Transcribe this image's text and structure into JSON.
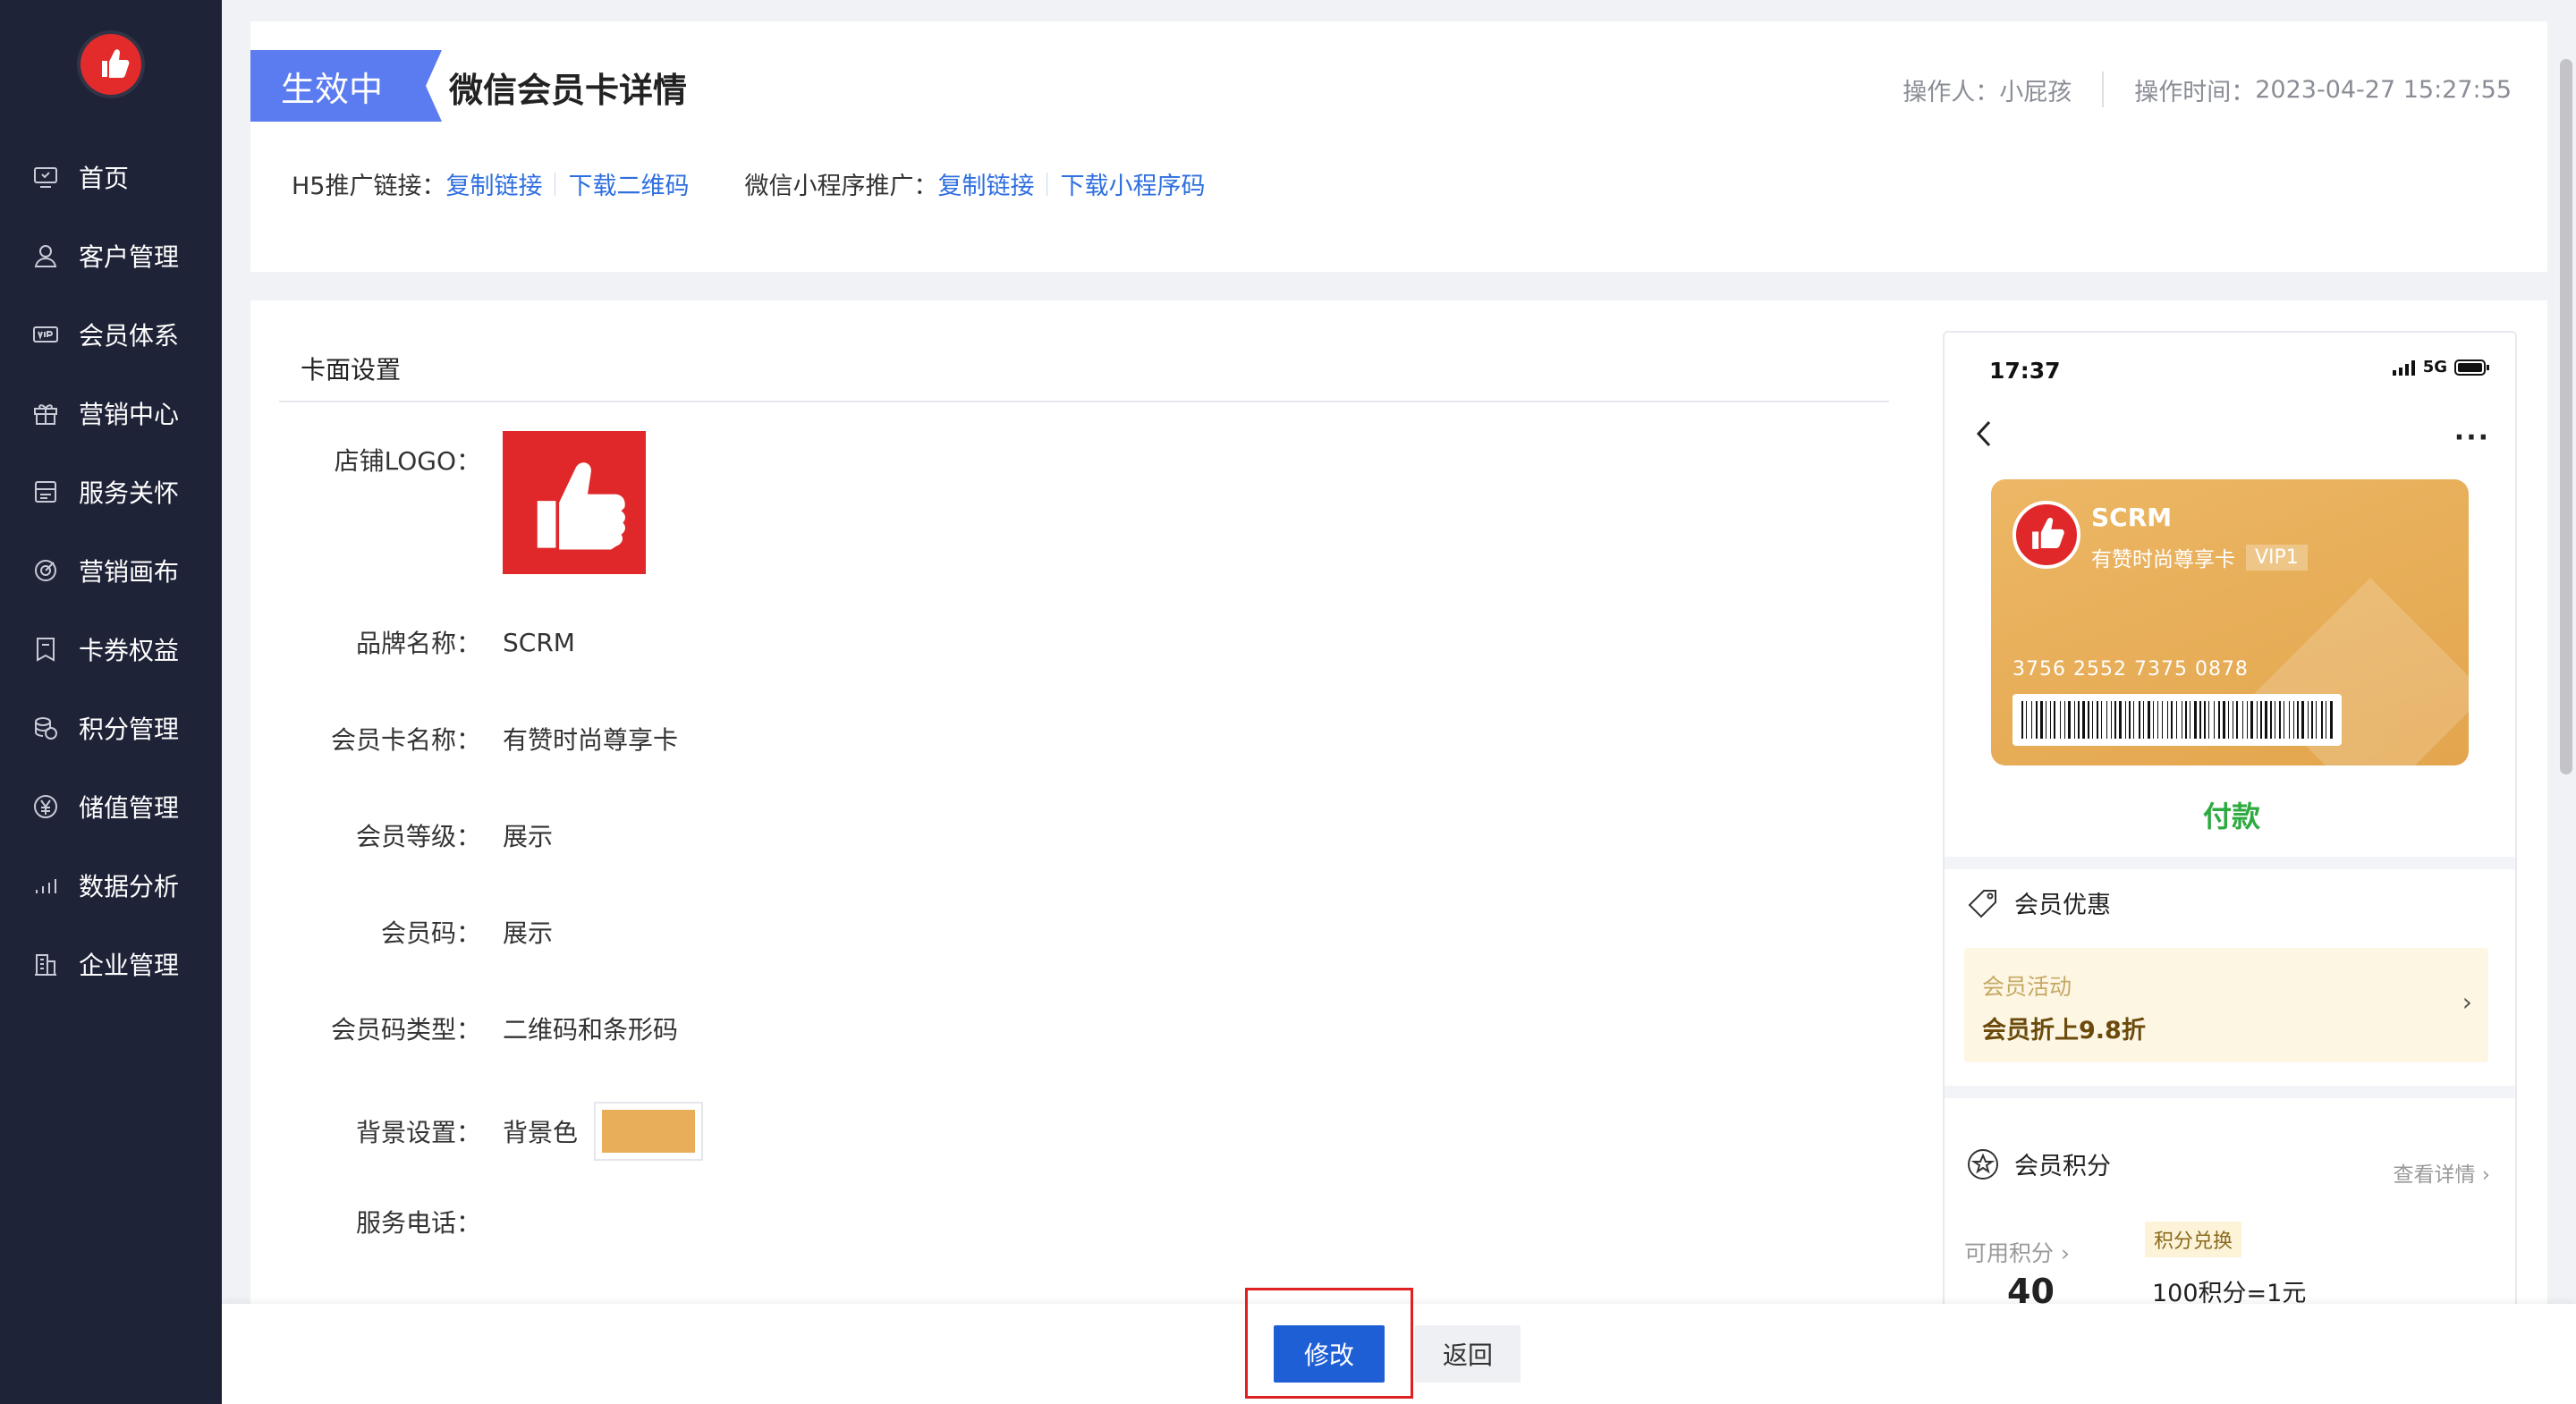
{
  "sidebar": {
    "logo_icon": "thumbs-up-icon",
    "items": [
      {
        "label": "首页",
        "icon": "home-icon"
      },
      {
        "label": "客户管理",
        "icon": "user-icon"
      },
      {
        "label": "会员体系",
        "icon": "vip-card-icon"
      },
      {
        "label": "营销中心",
        "icon": "gift-icon"
      },
      {
        "label": "服务关怀",
        "icon": "service-icon"
      },
      {
        "label": "营销画布",
        "icon": "target-icon"
      },
      {
        "label": "卡券权益",
        "icon": "coupon-icon"
      },
      {
        "label": "积分管理",
        "icon": "coins-icon"
      },
      {
        "label": "储值管理",
        "icon": "yuan-icon"
      },
      {
        "label": "数据分析",
        "icon": "bar-chart-icon"
      },
      {
        "label": "企业管理",
        "icon": "building-icon"
      }
    ]
  },
  "header": {
    "status": "生效中",
    "title": "微信会员卡详情",
    "operator_label": "操作人：",
    "operator": "小屁孩",
    "time_label": "操作时间：",
    "time": "2023-04-27 15:27:55",
    "h5_label": "H5推广链接：",
    "h5_copy": "复制链接",
    "h5_qr": "下载二维码",
    "mini_label": "微信小程序推广：",
    "mini_copy": "复制链接",
    "mini_qr": "下载小程序码"
  },
  "form": {
    "section_title": "卡面设置",
    "logo_label": "店铺LOGO：",
    "brand_label": "品牌名称：",
    "brand_value": "SCRM",
    "card_name_label": "会员卡名称：",
    "card_name_value": "有赞时尚尊享卡",
    "level_label": "会员等级：",
    "level_value": "展示",
    "code_label": "会员码：",
    "code_value": "展示",
    "code_type_label": "会员码类型：",
    "code_type_value": "二维码和条形码",
    "bg_label": "背景设置：",
    "bg_value": "背景色",
    "bg_color": "#e9ae5a",
    "phone_label": "服务电话："
  },
  "preview": {
    "time": "17:37",
    "network": "5G",
    "more": "···",
    "brand": "SCRM",
    "card_name": "有赞时尚尊享卡",
    "vip_level": "VIP1",
    "card_number": "3756 2552 7375 0878",
    "pay": "付款",
    "benefits_title": "会员优惠",
    "activity_sub": "会员活动",
    "activity_main": "会员折上9.8折",
    "points_title": "会员积分",
    "view_detail": "查看详情 ›",
    "points_label": "可用积分 ›",
    "points_value": "40",
    "exchange_tag": "积分兑换",
    "exchange_rate": "100积分=1元"
  },
  "footer": {
    "edit": "修改",
    "back": "返回"
  },
  "colors": {
    "sidebar_bg": "#1f2337",
    "badge": "#5b7bf0",
    "link": "#2f6fdf",
    "primary_button": "#1f5fd6",
    "highlight": "#e02020",
    "card_gold": "#e9ae5a",
    "pay_green": "#2eaa40"
  }
}
